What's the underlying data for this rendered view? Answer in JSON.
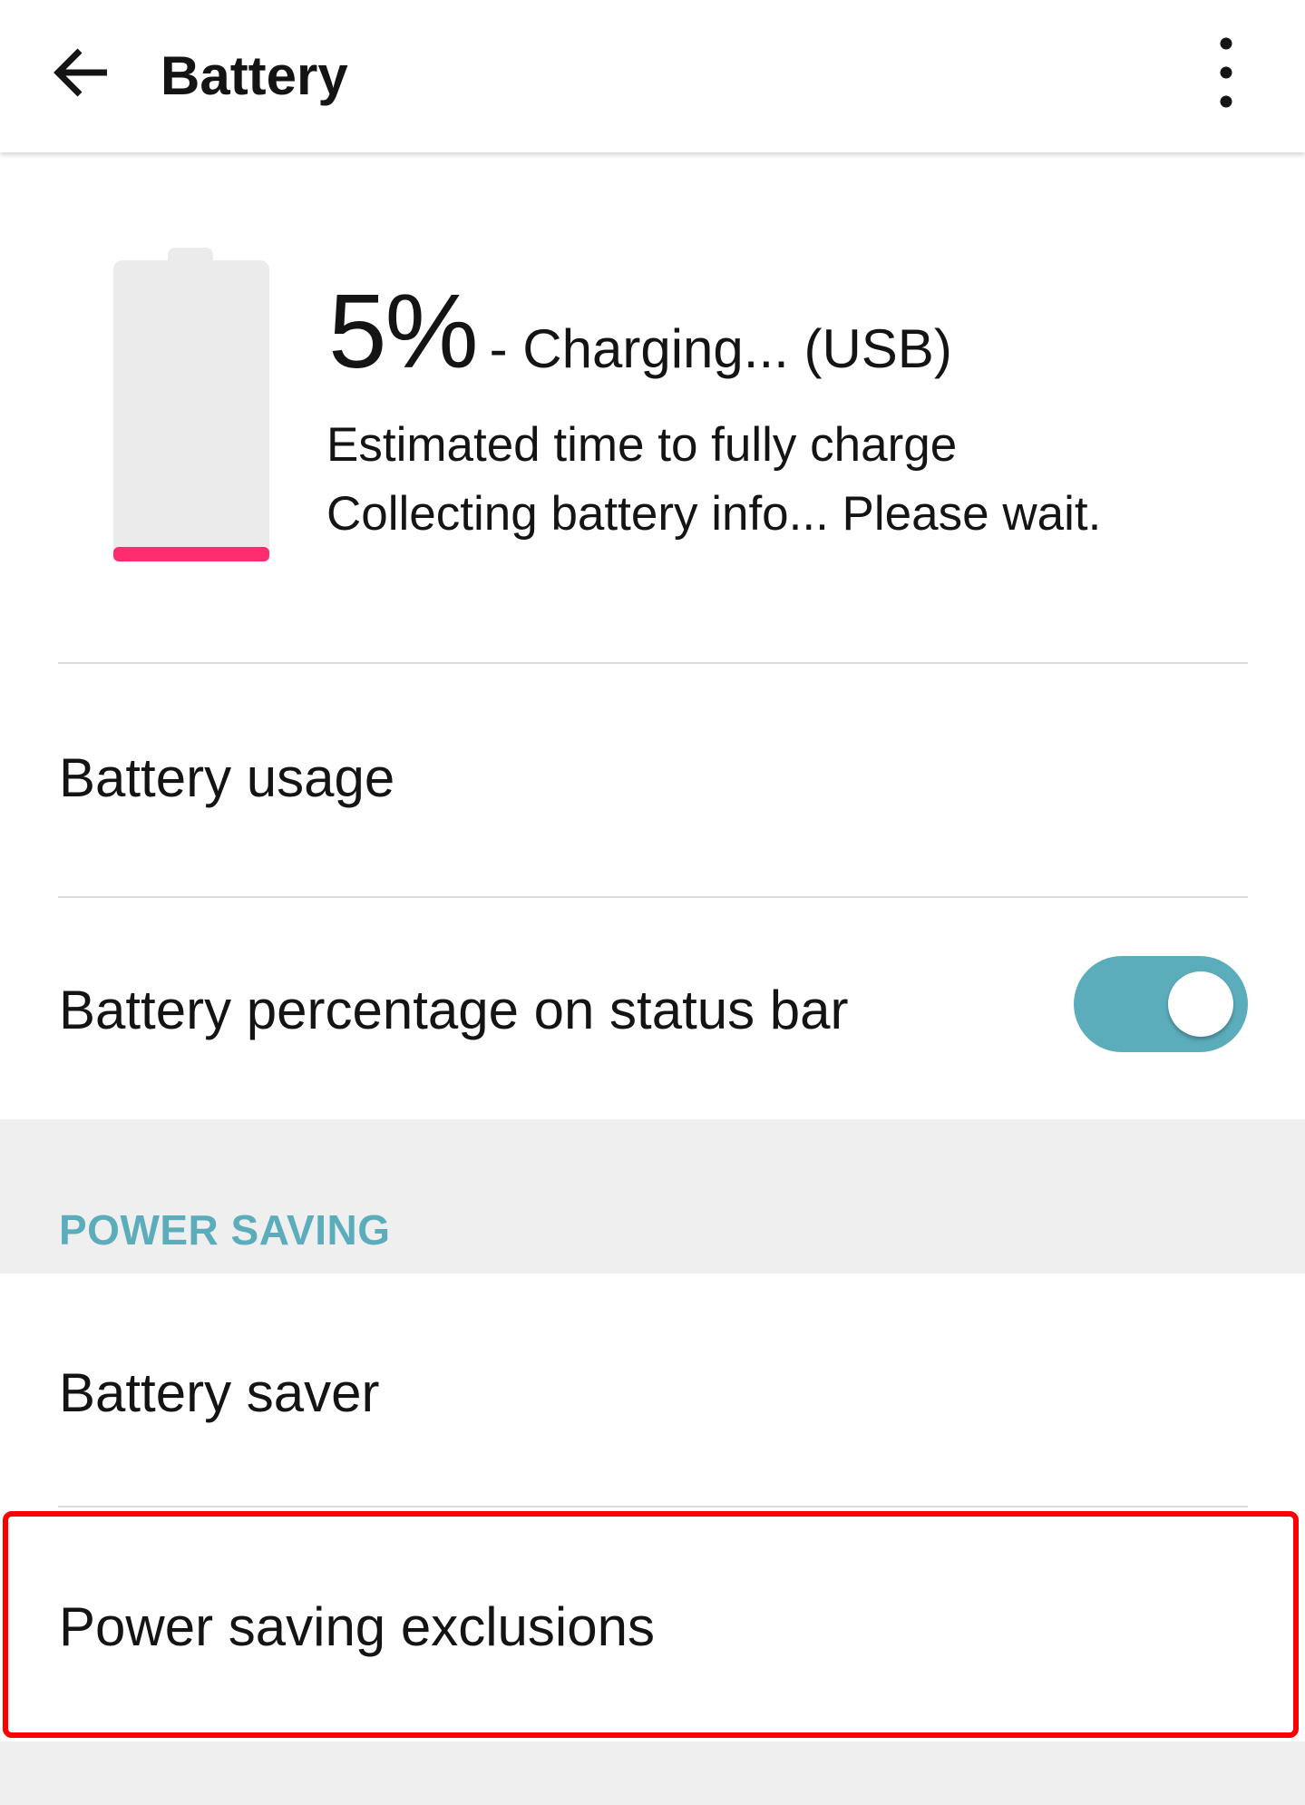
{
  "app_bar": {
    "title": "Battery",
    "back_icon": "arrow-left-icon",
    "overflow_icon": "more-vert-icon"
  },
  "battery": {
    "level_percent": 5,
    "level_text": "5%",
    "status": "- Charging... (USB)",
    "estimate_label": "Estimated time to fully charge",
    "estimate_value": "Collecting battery info... Please wait.",
    "level_color": "#ff2d6f",
    "body_color": "#ebebeb"
  },
  "settings": {
    "battery_usage": "Battery usage",
    "percentage_on_status_bar": {
      "label": "Battery percentage on status bar",
      "enabled": true,
      "accent_color": "#5badbc"
    }
  },
  "power_saving": {
    "header": "POWER SAVING",
    "battery_saver": "Battery saver",
    "exclusions": "Power saving exclusions"
  },
  "colors": {
    "accent": "#5badbc",
    "highlight": "#ff0000",
    "background": "#efefef"
  }
}
